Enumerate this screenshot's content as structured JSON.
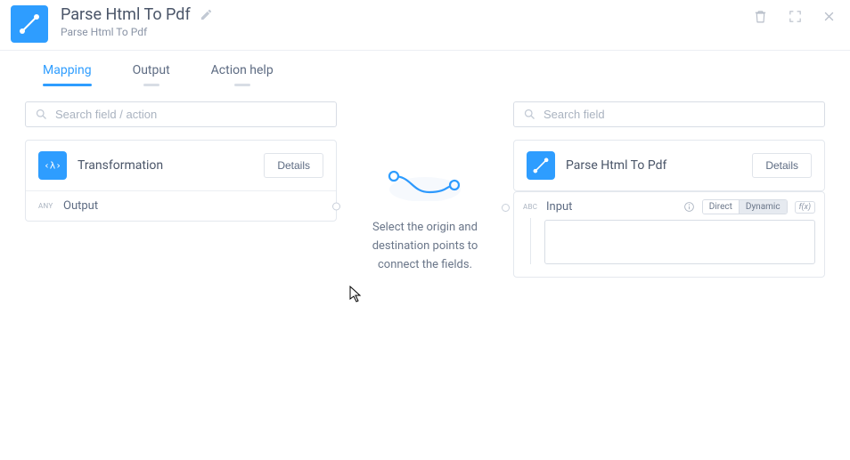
{
  "header": {
    "title": "Parse Html To Pdf",
    "subtitle": "Parse Html To Pdf"
  },
  "tabs": {
    "mapping": "Mapping",
    "output": "Output",
    "action_help": "Action help",
    "active": "mapping"
  },
  "left": {
    "search_placeholder": "Search field / action",
    "card_title": "Transformation",
    "details_label": "Details",
    "field_type": "any",
    "field_label": "Output"
  },
  "right": {
    "search_placeholder": "Search field",
    "card_title": "Parse Html To Pdf",
    "details_label": "Details",
    "field_type": "abc",
    "field_label": "Input",
    "mode_direct": "Direct",
    "mode_dynamic": "Dynamic",
    "mode_selected": "Dynamic",
    "fx_label": "f(x)",
    "textarea_value": ""
  },
  "middle": {
    "hint": "Select the origin and destination points to connect the fields."
  },
  "colors": {
    "accent": "#2e9dff"
  }
}
